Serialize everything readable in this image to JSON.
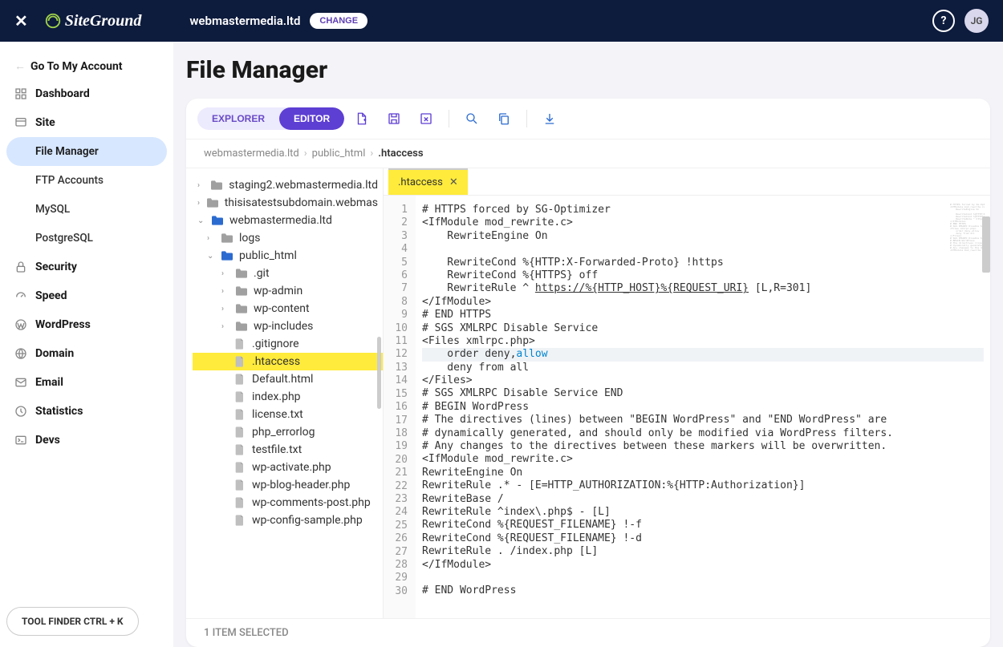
{
  "topbar": {
    "logo_text": "SiteGround",
    "domain": "webmastermedia.ltd",
    "change_label": "CHANGE",
    "avatar_initials": "JG"
  },
  "sidebar": {
    "back_label": "Go To My Account",
    "items": [
      {
        "label": "Dashboard",
        "icon": "dashboard"
      },
      {
        "label": "Site",
        "icon": "site",
        "expanded": true,
        "subs": [
          {
            "label": "File Manager",
            "active": true
          },
          {
            "label": "FTP Accounts"
          },
          {
            "label": "MySQL"
          },
          {
            "label": "PostgreSQL"
          }
        ]
      },
      {
        "label": "Security",
        "icon": "lock"
      },
      {
        "label": "Speed",
        "icon": "speed"
      },
      {
        "label": "WordPress",
        "icon": "wp"
      },
      {
        "label": "Domain",
        "icon": "globe"
      },
      {
        "label": "Email",
        "icon": "mail"
      },
      {
        "label": "Statistics",
        "icon": "stats"
      },
      {
        "label": "Devs",
        "icon": "terminal"
      }
    ],
    "tool_finder": "TOOL FINDER CTRL + K"
  },
  "page_title": "File Manager",
  "toolbar": {
    "explorer_label": "EXPLORER",
    "editor_label": "EDITOR"
  },
  "breadcrumb": [
    "webmastermedia.ltd",
    "public_html",
    ".htaccess"
  ],
  "tree": [
    {
      "indent": 0,
      "type": "folder",
      "chev": "right",
      "label": "staging2.webmastermedia.ltd"
    },
    {
      "indent": 0,
      "type": "folder",
      "chev": "right",
      "label": "thisisatestsubdomain.webmas"
    },
    {
      "indent": 0,
      "type": "folder-open",
      "chev": "down",
      "label": "webmastermedia.ltd"
    },
    {
      "indent": 1,
      "type": "folder",
      "chev": "right",
      "label": "logs"
    },
    {
      "indent": 1,
      "type": "folder-open",
      "chev": "down",
      "label": "public_html"
    },
    {
      "indent": 2,
      "type": "folder",
      "chev": "right",
      "label": ".git"
    },
    {
      "indent": 2,
      "type": "folder",
      "chev": "right",
      "label": "wp-admin"
    },
    {
      "indent": 2,
      "type": "folder",
      "chev": "right",
      "label": "wp-content"
    },
    {
      "indent": 2,
      "type": "folder",
      "chev": "right",
      "label": "wp-includes"
    },
    {
      "indent": 2,
      "type": "file",
      "label": ".gitignore"
    },
    {
      "indent": 2,
      "type": "file",
      "label": ".htaccess",
      "selected": true
    },
    {
      "indent": 2,
      "type": "file",
      "label": "Default.html"
    },
    {
      "indent": 2,
      "type": "file",
      "label": "index.php"
    },
    {
      "indent": 2,
      "type": "file",
      "label": "license.txt"
    },
    {
      "indent": 2,
      "type": "file",
      "label": "php_errorlog"
    },
    {
      "indent": 2,
      "type": "file",
      "label": "testfile.txt"
    },
    {
      "indent": 2,
      "type": "file",
      "label": "wp-activate.php"
    },
    {
      "indent": 2,
      "type": "file",
      "label": "wp-blog-header.php"
    },
    {
      "indent": 2,
      "type": "file",
      "label": "wp-comments-post.php"
    },
    {
      "indent": 2,
      "type": "file",
      "label": "wp-config-sample.php"
    }
  ],
  "tab": {
    "name": ".htaccess"
  },
  "code": {
    "lines": [
      "# HTTPS forced by SG-Optimizer",
      "<IfModule mod_rewrite.c>",
      "    RewriteEngine On",
      "",
      "    RewriteCond %{HTTP:X-Forwarded-Proto} !https",
      "    RewriteCond %{HTTPS} off",
      "    RewriteRule ^ https://%{HTTP_HOST}%{REQUEST_URI} [L,R=301]",
      "</IfModule>",
      "# END HTTPS",
      "# SGS XMLRPC Disable Service",
      "<Files xmlrpc.php>",
      "    order deny,allow",
      "    deny from all",
      "</Files>",
      "# SGS XMLRPC Disable Service END",
      "# BEGIN WordPress",
      "# The directives (lines) between \"BEGIN WordPress\" and \"END WordPress\" are",
      "# dynamically generated, and should only be modified via WordPress filters.",
      "# Any changes to the directives between these markers will be overwritten.",
      "<IfModule mod_rewrite.c>",
      "RewriteEngine On",
      "RewriteRule .* - [E=HTTP_AUTHORIZATION:%{HTTP:Authorization}]",
      "RewriteBase /",
      "RewriteRule ^index\\.php$ - [L]",
      "RewriteCond %{REQUEST_FILENAME} !-f",
      "RewriteCond %{REQUEST_FILENAME} !-d",
      "RewriteRule . /index.php [L]",
      "</IfModule>",
      "",
      "# END WordPress"
    ],
    "highlight_line": 12
  },
  "statusbar": "1 ITEM SELECTED"
}
